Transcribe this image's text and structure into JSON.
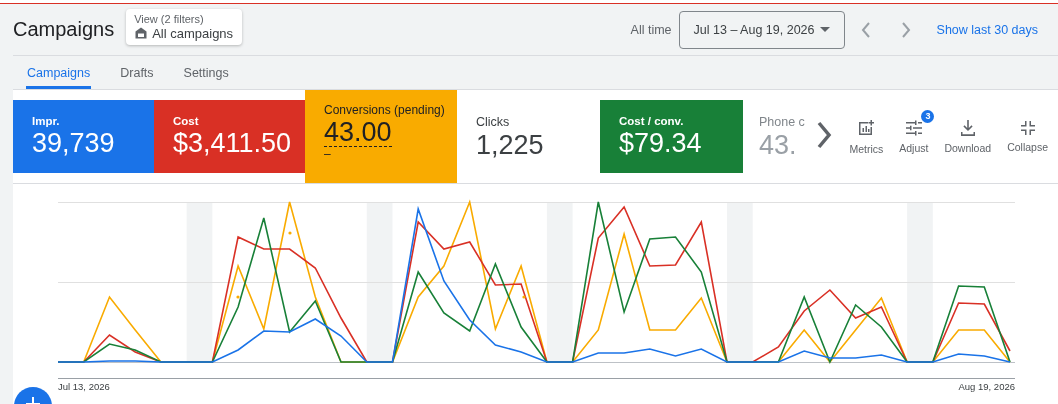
{
  "header": {
    "title": "Campaigns",
    "view": {
      "label": "View (2 filters)",
      "value": "All campaigns"
    },
    "range_label": "All time",
    "date_range": "Jul 13 – Aug 19, 2026",
    "link": "Show last 30 days"
  },
  "tabs": [
    {
      "label": "Campaigns",
      "selected": true
    },
    {
      "label": "Drafts",
      "selected": false
    },
    {
      "label": "Settings",
      "selected": false
    }
  ],
  "metric_cards": [
    {
      "label": "Impr.",
      "value": "39,739",
      "color": "#1a73e8"
    },
    {
      "label": "Cost",
      "value": "$3,411.50",
      "color": "#d93025"
    },
    {
      "label": "Conversions (pending)",
      "value": "43.00",
      "note": "–",
      "color": "#f9ab00"
    },
    {
      "label": "Clicks",
      "value": "1,225"
    },
    {
      "label": "Cost / conv.",
      "value": "$79.34",
      "color": "#188038"
    },
    {
      "label": "Phone c",
      "value": "43.",
      "faded": true
    }
  ],
  "toolbar": [
    {
      "kind": "metrics",
      "label": "Metrics"
    },
    {
      "kind": "adjust",
      "label": "Adjust",
      "badge": "3"
    },
    {
      "kind": "download",
      "label": "Download"
    },
    {
      "kind": "collapse",
      "label": "Collapse"
    }
  ],
  "chart": {
    "x_start": "Jul 13, 2026",
    "x_end": "Aug 19, 2026"
  }
}
